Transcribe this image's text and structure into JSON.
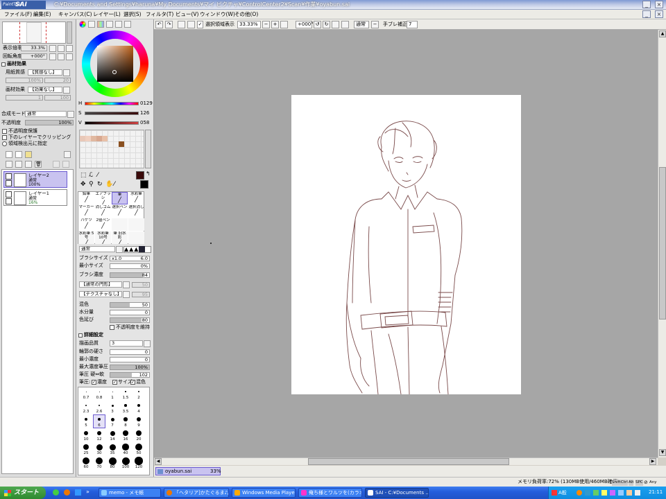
{
  "app": {
    "logo_small": "PaintTool",
    "logo": "SAI",
    "title": "C:¥Documents and Settings¥haruna¥My Documents¥マイ ピクチャ¥ControlCenter2¥Scan¥作業¥oyabun.sai"
  },
  "menu": [
    "ファイル(F)",
    "編集(E)",
    "キャンバス(C)",
    "レイヤー(L)",
    "選択(S)",
    "フィルタ(T)",
    "ビュー(V)",
    "ウィンドウ(W)",
    "その他(O)"
  ],
  "toolbar": {
    "selection_checkbox_label": "選択領域表示",
    "zoom": "33.33%",
    "rotation": "+000°",
    "blend_mode": "通常",
    "stabilizer_label": "手ブレ補正",
    "stabilizer_value": "7"
  },
  "navigator": {
    "zoom_label": "表示倍率",
    "zoom_value": "33.3%",
    "angle_label": "回転角度",
    "angle_value": "+000°"
  },
  "paper": {
    "header": "画材効果",
    "texture_label": "用紙質感",
    "texture_value": "【質感なし】",
    "texture_scale": "100%",
    "texture_strength": "20",
    "effect_label": "画材効果",
    "effect_value": "【効果なし】",
    "effect_width": "1",
    "effect_strength": "100"
  },
  "layer_props": {
    "mode_label": "合成モード",
    "mode_value": "通常",
    "opacity_label": "不透明度",
    "opacity_value": "100%",
    "opt1": "不透明度保護",
    "opt2": "下のレイヤーでクリッピング",
    "opt3": "領域検出元に指定"
  },
  "layers": [
    {
      "name": "レイヤー2",
      "mode": "通常",
      "opacity": "100%",
      "selected": true
    },
    {
      "name": "レイヤー1",
      "mode": "通常",
      "opacity": "16%",
      "selected": false
    }
  ],
  "color": {
    "h_label": "H",
    "h_value": "0129",
    "s_label": "S",
    "s_value": "126",
    "v_label": "V",
    "v_value": "058",
    "main": "#3a0a0a",
    "swatches": [
      "#e8c8b8",
      "#f0d0c0",
      "#e0b8a0",
      "#d8a890",
      "#8a5020"
    ]
  },
  "tools": [
    {
      "label": "鉛筆"
    },
    {
      "label": "エアブラシ"
    },
    {
      "label": "筆"
    },
    {
      "label": "水彩筆"
    },
    {
      "label": "マーカー"
    },
    {
      "label": "消しゴム"
    },
    {
      "label": "選択ペン"
    },
    {
      "label": "選択消し"
    },
    {
      "label": "バケツ"
    },
    {
      "label": "2値ペン"
    },
    {
      "label": ""
    },
    {
      "label": ""
    },
    {
      "label": "水彩筆 5号"
    },
    {
      "label": "水彩筆 10号"
    },
    {
      "label": "筆 旧水彩"
    },
    {
      "label": ""
    }
  ],
  "brush": {
    "mode": "通常",
    "size_label": "ブラシサイズ",
    "size_mult": "x1.0",
    "size_value": "6.0",
    "min_size_label": "最小サイズ",
    "min_size_value": "0%",
    "density_label": "ブラシ濃度",
    "density_value": "84",
    "shape_value": "【通常の円形】",
    "shape_strength": "50",
    "texture_value": "【テクスチャなし】",
    "texture_strength": "95",
    "blend_label": "混色",
    "blend_value": "50",
    "water_label": "水分量",
    "water_value": "0",
    "persist_label": "色延び",
    "persist_value": "80",
    "keep_opacity": "不透明度を維持",
    "detail_header": "詳細設定",
    "quality_label": "描画品質",
    "quality_value": "3",
    "edge_label": "輪郭の硬さ",
    "edge_value": "0",
    "min_density_label": "最小濃度",
    "min_density_value": "0",
    "max_pressure_label": "最大濃度筆圧",
    "max_pressure_value": "100%",
    "pressure_label": "筆圧 硬⇔軟",
    "pressure_value": "102",
    "pressure_row": "筆圧:",
    "p_density": "濃度",
    "p_size": "サイズ",
    "p_blend": "混色"
  },
  "brush_sizes": [
    "0.7",
    "0.8",
    "1",
    "1.5",
    "2",
    "2.3",
    "2.6",
    "3",
    "3.5",
    "4",
    "5",
    "6",
    "7",
    "8",
    "9",
    "10",
    "12",
    "14",
    "16",
    "20",
    "25",
    "30",
    "35",
    "40",
    "50",
    "60",
    "70",
    "80",
    "100",
    "120"
  ],
  "doc_tab": {
    "name": "oyabun.sai",
    "zoom": "33%"
  },
  "status": {
    "memory": "メモリ負荷率:72% (130MB使用/460MB確保)",
    "keys": [
      "Shift",
      "Ctrl",
      "Alt",
      "SPC"
    ],
    "any": "Any"
  },
  "taskbar": {
    "start": "スタート",
    "items": [
      "memo - メモ帳",
      "「ヘタリア]かたぐるま♪/...",
      "Windows Media Player",
      "俺ち様とワルツを(カラオ...",
      "SAI - C:¥Documents ..."
    ],
    "tray_ime": "A般",
    "time": "21:11"
  }
}
